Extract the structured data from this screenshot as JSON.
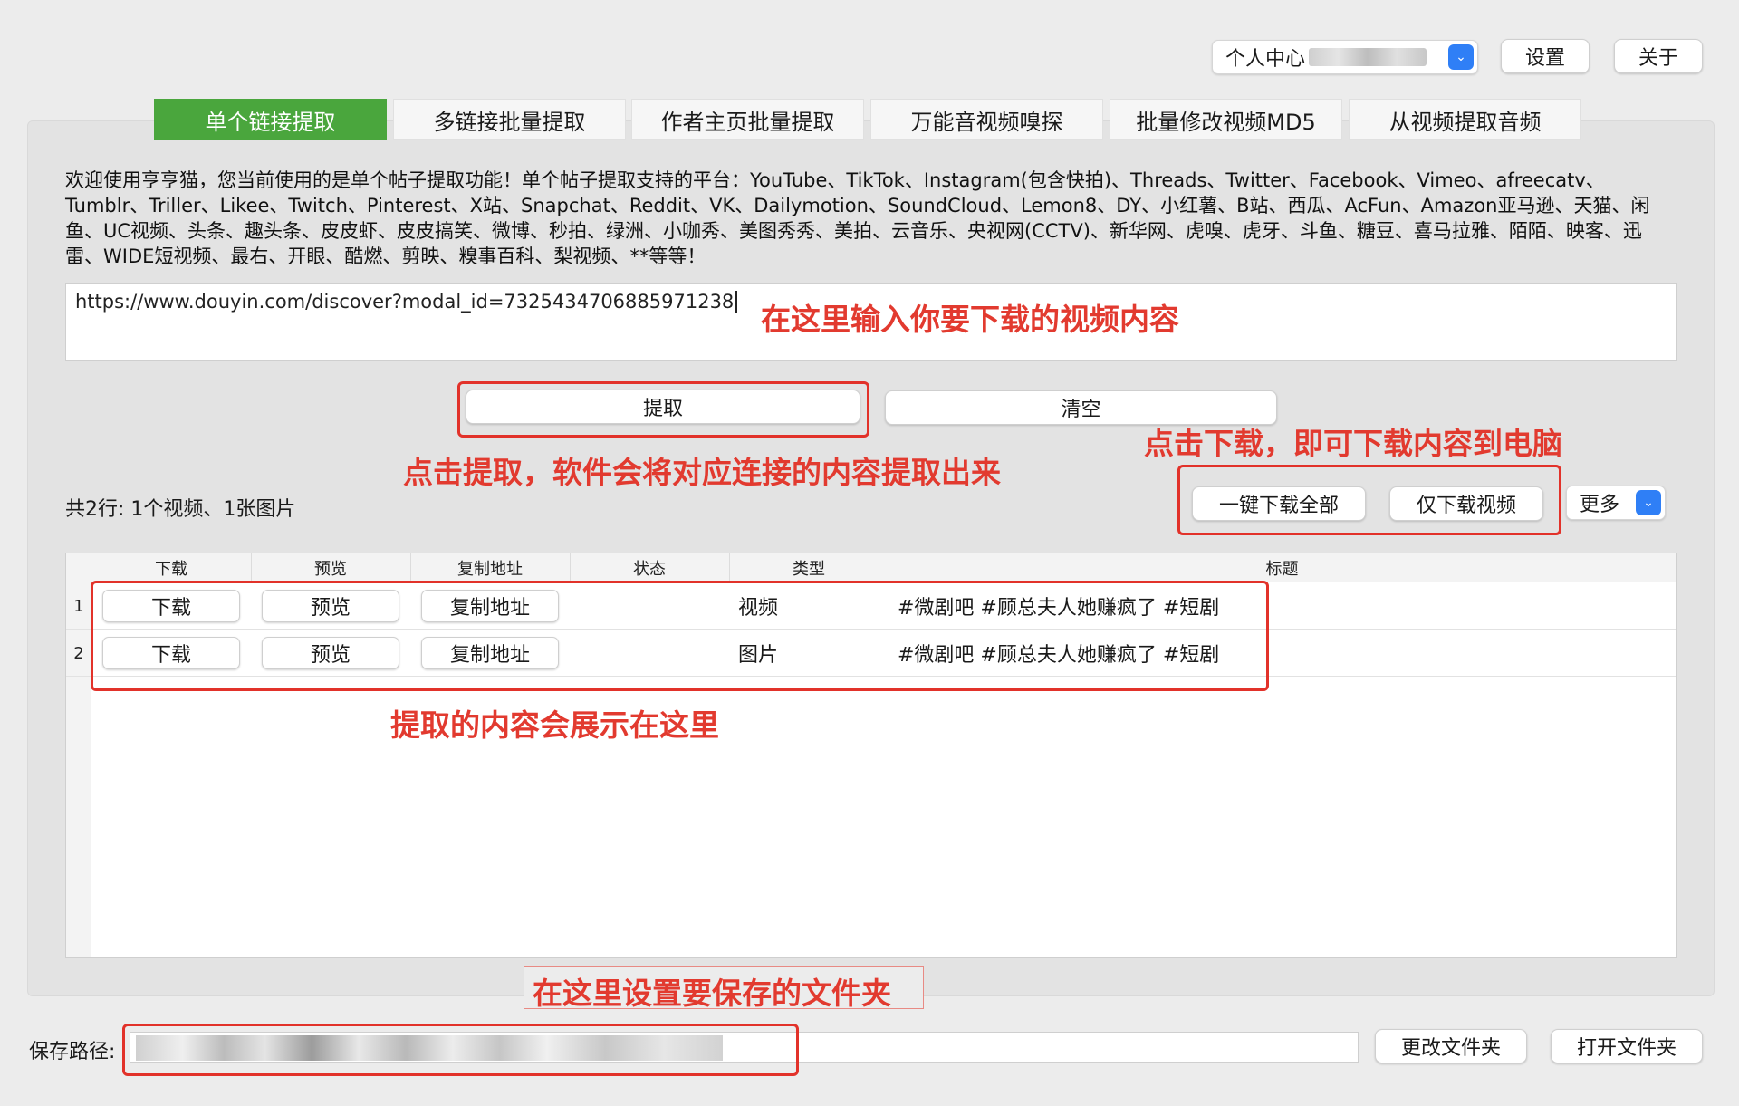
{
  "header": {
    "user_dropdown_label": "个人中心",
    "settings_label": "设置",
    "about_label": "关于"
  },
  "tabs": [
    {
      "label": "单个链接提取",
      "active": true
    },
    {
      "label": "多链接批量提取",
      "active": false
    },
    {
      "label": "作者主页批量提取",
      "active": false
    },
    {
      "label": "万能音视频嗅探",
      "active": false
    },
    {
      "label": "批量修改视频MD5",
      "active": false
    },
    {
      "label": "从视频提取音频",
      "active": false
    }
  ],
  "intro_text": "欢迎使用亨亨猫，您当前使用的是单个帖子提取功能！单个帖子提取支持的平台：YouTube、TikTok、Instagram(包含快拍)、Threads、Twitter、Facebook、Vimeo、afreecatv、Tumblr、Triller、Likee、Twitch、Pinterest、X站、Snapchat、Reddit、VK、Dailymotion、SoundCloud、Lemon8、DY、小红薯、B站、西瓜、AcFun、Amazon亚马逊、天猫、闲鱼、UC视频、头条、趣头条、皮皮虾、皮皮搞笑、微博、秒拍、绿洲、小咖秀、美图秀秀、美拍、云音乐、央视网(CCTV)、新华网、虎嗅、虎牙、斗鱼、糖豆、喜马拉雅、陌陌、映客、迅雷、WIDE短视频、最右、开眼、酷燃、剪映、糗事百科、梨视频、**等等！",
  "url_input": {
    "value": "https://www.douyin.com/discover?modal_id=7325434706885971238"
  },
  "actions": {
    "extract_label": "提取",
    "clear_label": "清空",
    "download_all_label": "一键下载全部",
    "download_video_label": "仅下载视频",
    "more_label": "更多"
  },
  "summary": "共2行: 1个视频、1张图片",
  "table": {
    "columns": [
      "下载",
      "预览",
      "复制地址",
      "状态",
      "类型",
      "标题"
    ],
    "rows": [
      {
        "num": "1",
        "download": "下载",
        "preview": "预览",
        "copy": "复制地址",
        "status": "",
        "type": "视频",
        "title": "#微剧吧  #顾总夫人她赚疯了 #短剧"
      },
      {
        "num": "2",
        "download": "下载",
        "preview": "预览",
        "copy": "复制地址",
        "status": "",
        "type": "图片",
        "title": "#微剧吧  #顾总夫人她赚疯了 #短剧"
      }
    ]
  },
  "annotations": {
    "input_hint": "在这里输入你要下载的视频内容",
    "extract_hint": "点击提取，软件会将对应连接的内容提取出来",
    "download_hint": "点击下载，即可下载内容到电脑",
    "results_hint": "提取的内容会展示在这里",
    "folder_hint": "在这里设置要保存的文件夹"
  },
  "save_path": {
    "label": "保存路径:",
    "change_folder_label": "更改文件夹",
    "open_folder_label": "打开文件夹"
  },
  "colors": {
    "active_tab": "#4aa63d",
    "annotation": "#e2322a",
    "accent_blue": "#2f7ff6"
  }
}
